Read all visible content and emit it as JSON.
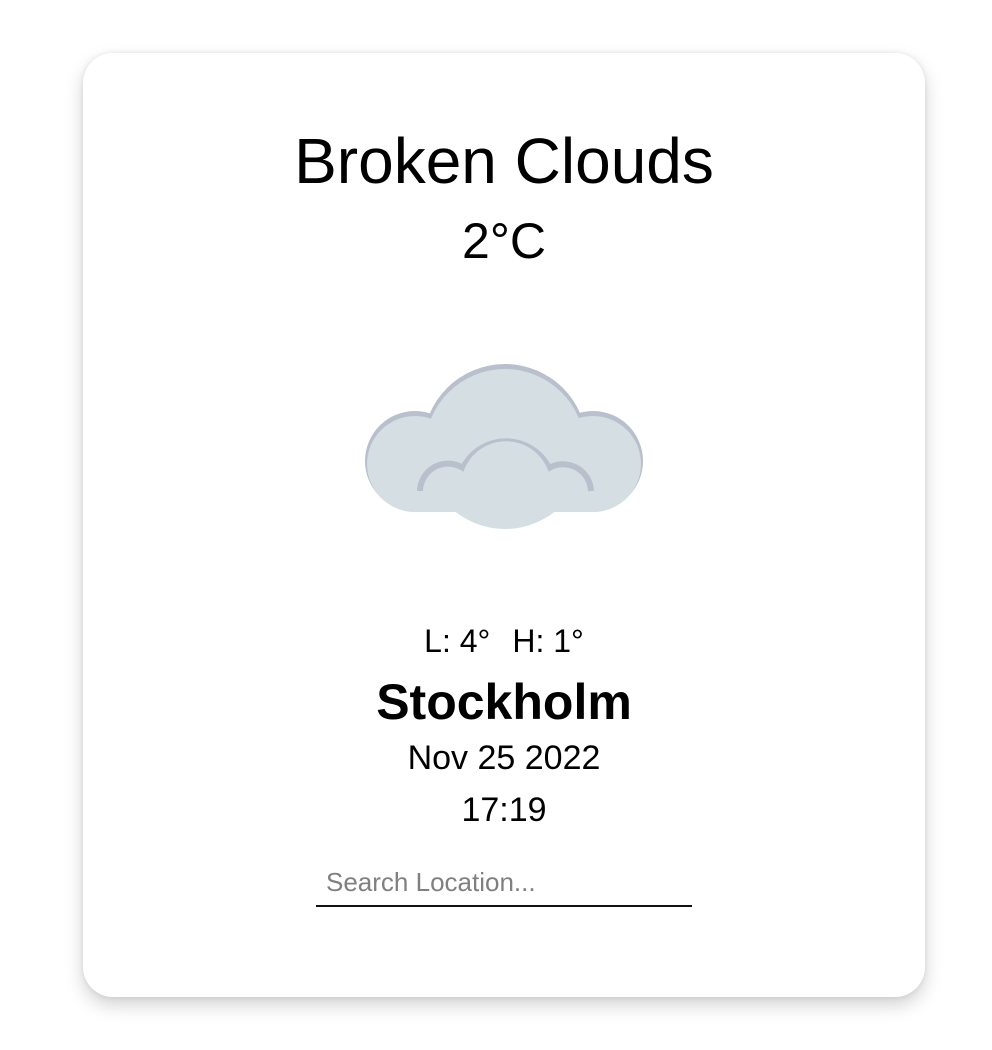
{
  "weather": {
    "condition": "Broken Clouds",
    "temperature": "2°C",
    "icon": "broken-clouds-icon",
    "low": "L: 4°",
    "high": "H: 1°",
    "city": "Stockholm",
    "date": "Nov 25 2022",
    "time": "17:19"
  },
  "search": {
    "placeholder": "Search Location...",
    "value": ""
  },
  "colors": {
    "cloud_fill": "#d5dee2",
    "cloud_shadow": "#b9bfcd",
    "card_background": "#ffffff"
  }
}
